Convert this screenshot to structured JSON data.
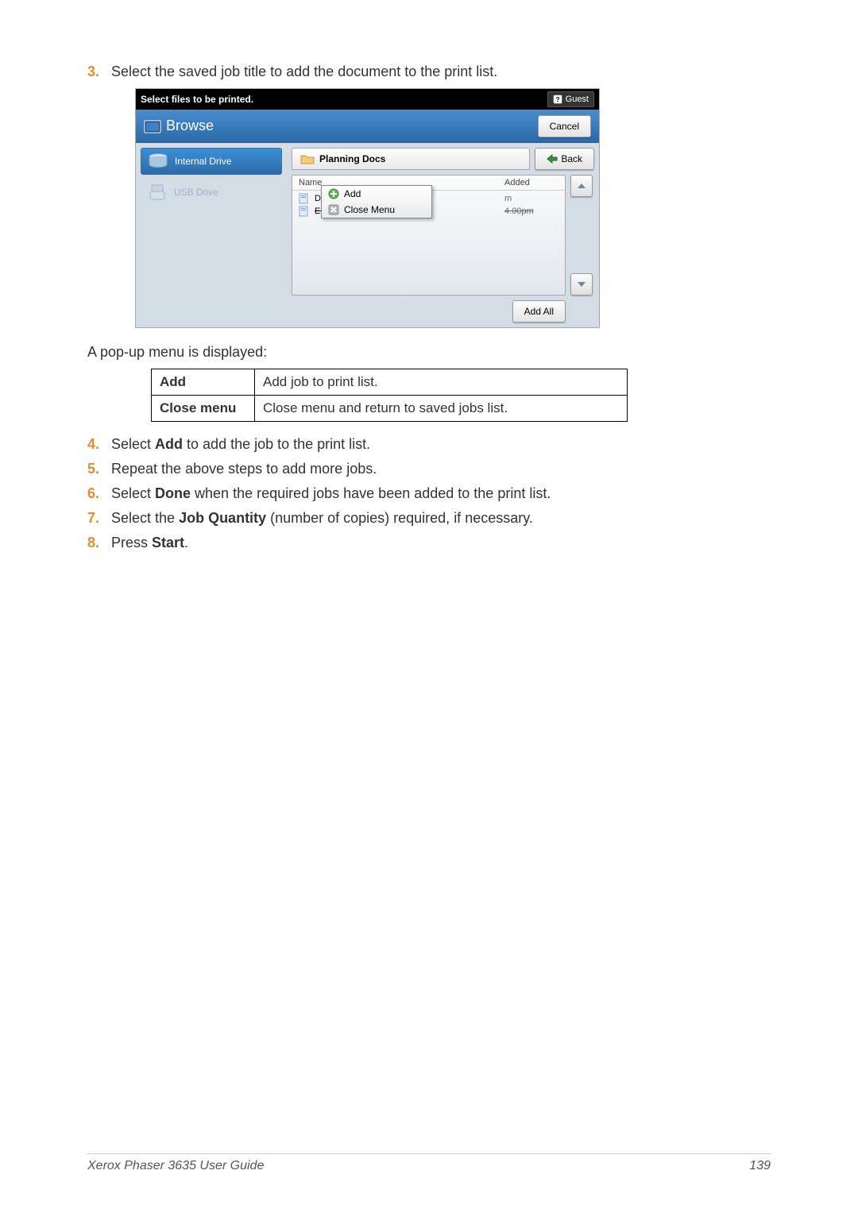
{
  "steps": {
    "s3": {
      "num": "3.",
      "text_before": "Select the saved job title to add the document to the print list."
    },
    "s4": {
      "num": "4.",
      "prefix": "Select ",
      "bold": "Add",
      "suffix": " to add the job to the print list."
    },
    "s5": {
      "num": "5.",
      "text": "Repeat the above steps to add more jobs."
    },
    "s6": {
      "num": "6.",
      "prefix": "Select ",
      "bold": "Done",
      "suffix": " when the required jobs have been added to the print list."
    },
    "s7": {
      "num": "7.",
      "prefix": "Select the ",
      "bold": "Job Quantity",
      "suffix": " (number of copies) required, if necessary."
    },
    "s8": {
      "num": "8.",
      "prefix": "Press ",
      "bold": "Start",
      "suffix": "."
    }
  },
  "printer_ui": {
    "header_title": "Select files to be printed.",
    "guest_label": "Guest",
    "browse_label": "Browse",
    "cancel_label": "Cancel",
    "drives": {
      "internal": "Internal Drive",
      "usb": "USB Drive"
    },
    "folder_name": "Planning Docs",
    "back_label": "Back",
    "columns": {
      "name": "Name",
      "added": "Added"
    },
    "files": {
      "f1": {
        "name": "Dis",
        "meta": "m"
      },
      "f2": {
        "name": "Endeavor o",
        "meta": "4.00pm"
      }
    },
    "popup": {
      "add": "Add",
      "close": "Close Menu"
    },
    "add_all_label": "Add All"
  },
  "popup_desc": {
    "intro": "A pop-up menu is displayed:",
    "rows": {
      "add": {
        "k": "Add",
        "v": "Add job to print list."
      },
      "close": {
        "k": "Close menu",
        "v": "Close menu and return to saved jobs list."
      }
    }
  },
  "footer": {
    "left": "Xerox Phaser 3635 User Guide",
    "right": "139"
  }
}
